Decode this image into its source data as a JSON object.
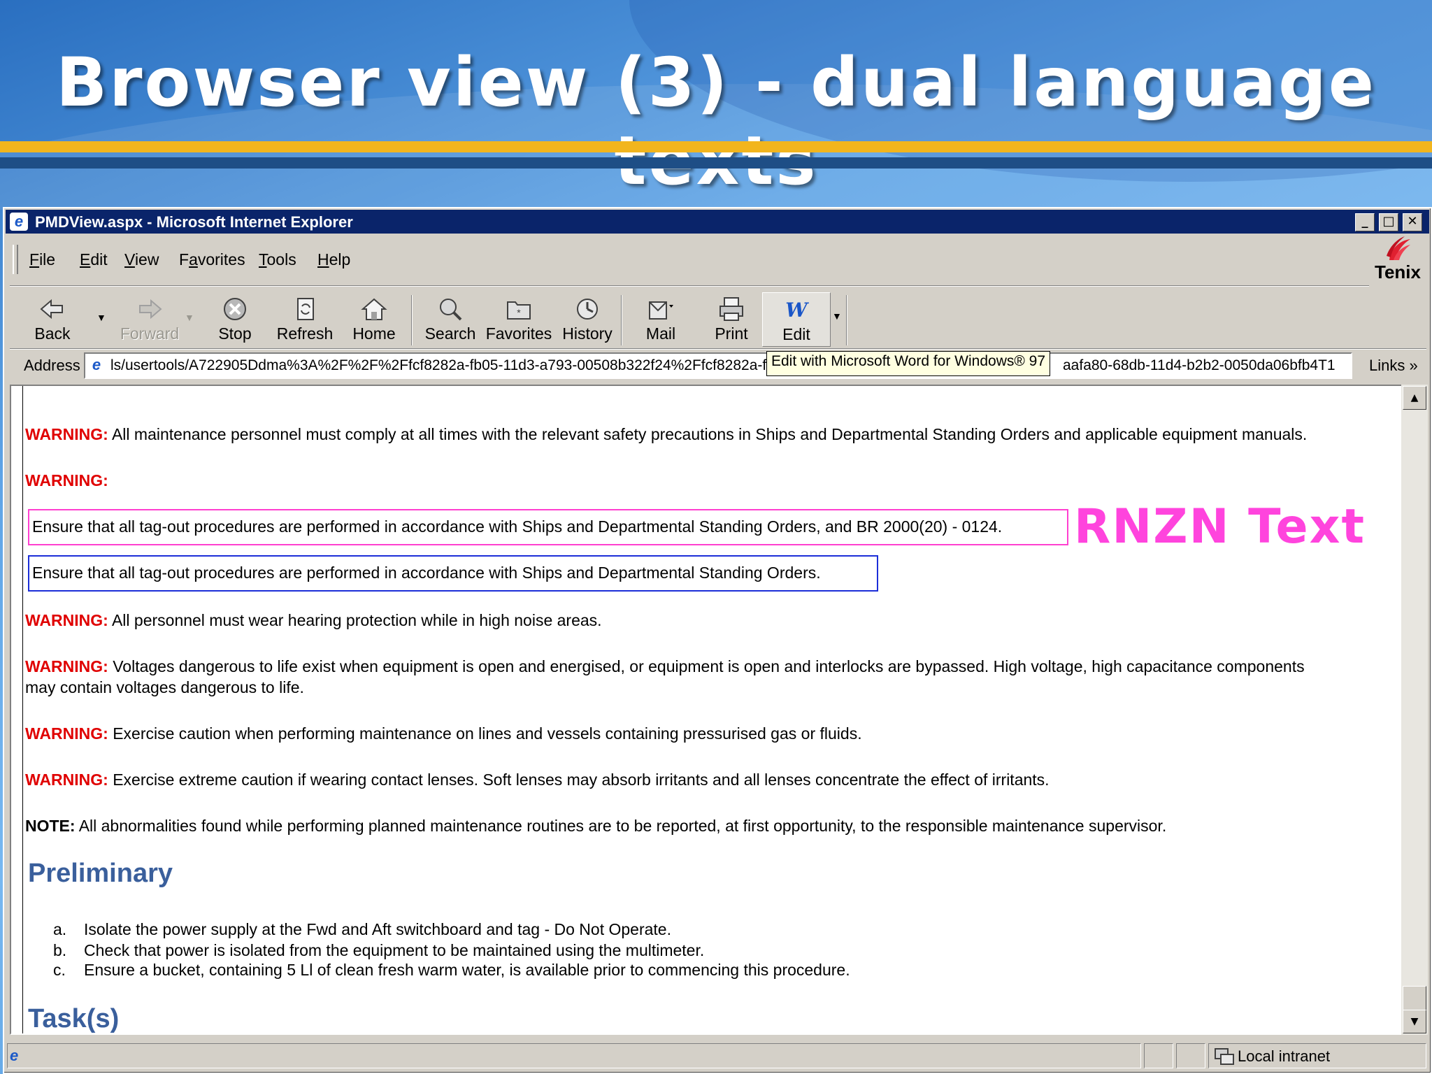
{
  "slide": {
    "title": "Browser view (3) - dual language texts",
    "annotation": "RNZN Text",
    "annotation_color": "#ff44dd"
  },
  "window": {
    "title": "PMDView.aspx - Microsoft Internet Explorer",
    "titlebar_color": "#0a246a"
  },
  "menu": {
    "items": [
      {
        "accel": "F",
        "rest": "ile"
      },
      {
        "accel": "E",
        "rest": "dit"
      },
      {
        "accel": "V",
        "rest": "iew"
      },
      {
        "pre": "F",
        "accel": "a",
        "rest": "vorites"
      },
      {
        "accel": "T",
        "rest": "ools"
      },
      {
        "accel": "H",
        "rest": "elp"
      }
    ],
    "brand": "Tenix"
  },
  "toolbar": {
    "back": "Back",
    "forward": "Forward",
    "stop": "Stop",
    "refresh": "Refresh",
    "home": "Home",
    "search": "Search",
    "favorites": "Favorites",
    "history": "History",
    "mail": "Mail",
    "print": "Print",
    "edit": "Edit"
  },
  "address": {
    "label": "Address",
    "url_left": "ls/usertools/A722905Ddma%3A%2F%2F%2Ffcf8282a-fb05-11d3-a793-00508b322f24%2Ffcf8282a-fb",
    "url_right": "aafa80-68db-11d4-b2b2-0050da06bfb4T1",
    "tooltip": "Edit with Microsoft Word for Windows® 97",
    "links": "Links"
  },
  "content": {
    "warning_label": "WARNING:",
    "note_label": "NOTE:",
    "w1": "All maintenance personnel must comply at all times with the relevant safety precautions in Ships and Departmental Standing Orders and applicable equipment manuals.",
    "rnzn_text": "Ensure that all tag-out procedures are performed in accordance with Ships and Departmental Standing Orders, and BR 2000(20) - 0124.",
    "std_text": "Ensure that all tag-out procedures are performed in accordance with Ships and Departmental Standing Orders.",
    "w3": "All personnel must wear hearing protection while in high noise areas.",
    "w4_line1": "Voltages dangerous to life exist when equipment is open and energised, or equipment is open and interlocks are bypassed. High voltage, high capacitance components",
    "w4_line2": "may contain voltages dangerous to life.",
    "w5": "Exercise caution when performing maintenance on lines and vessels containing pressurised gas or fluids.",
    "w6": "Exercise extreme caution if wearing contact lenses. Soft lenses may absorb irritants and all lenses concentrate the effect of irritants.",
    "note": "All abnormalities found while performing planned maintenance routines are to be reported, at first opportunity, to the responsible maintenance supervisor.",
    "heading_preliminary": "Preliminary",
    "list": [
      {
        "marker": "a.",
        "text": "Isolate the power supply at the Fwd and Aft switchboard and tag - Do Not Operate."
      },
      {
        "marker": "b.",
        "text": "Check that power is isolated from the equipment to be maintained using the multimeter."
      },
      {
        "marker": "c.",
        "text": "Ensure a bucket, containing 5 Ll of clean fresh warm water, is available prior to commencing this procedure."
      }
    ],
    "heading_tasks": "Task(s)",
    "warning_color": "#e00000",
    "heading_color": "#3a5f9c"
  },
  "status": {
    "zone": "Local intranet"
  }
}
